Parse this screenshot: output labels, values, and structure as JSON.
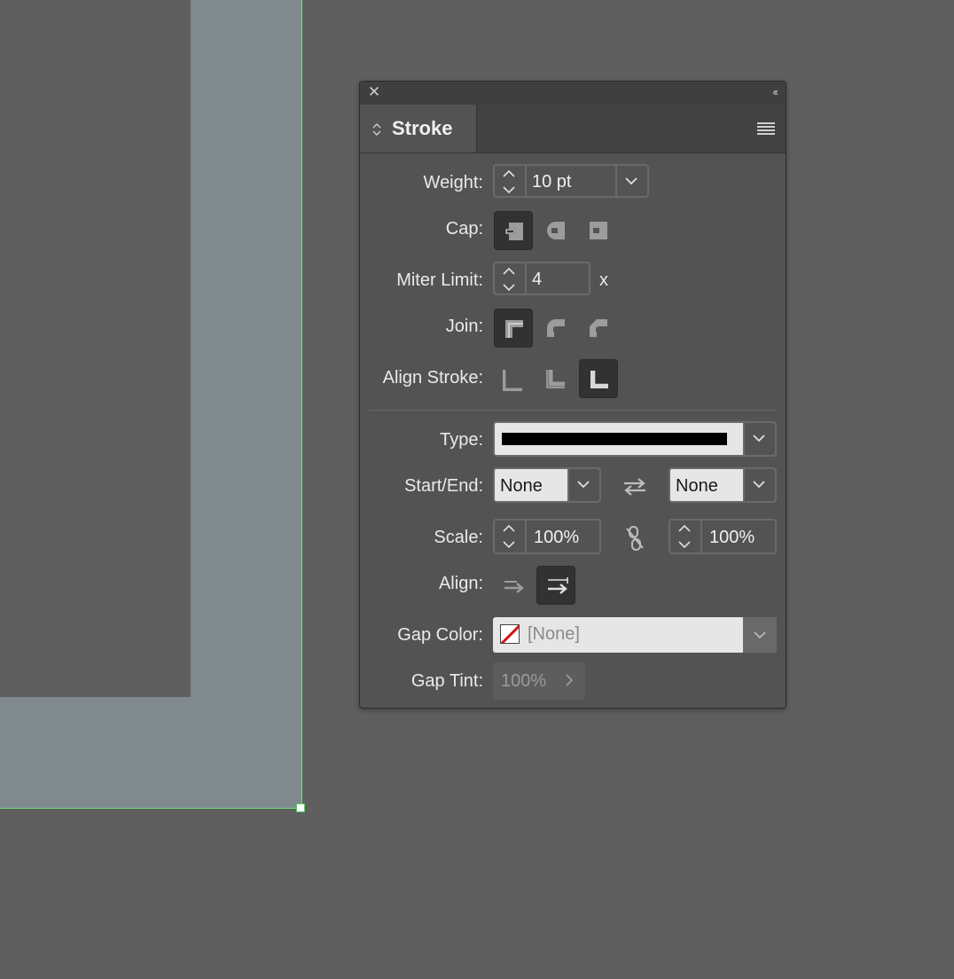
{
  "panel": {
    "close_icon": "close-icon",
    "collapse_icon": "double-chevron-left-icon",
    "tab_label": "Stroke",
    "menu_icon": "panel-menu-icon"
  },
  "labels": {
    "weight": "Weight:",
    "cap": "Cap:",
    "miter_limit": "Miter Limit:",
    "join": "Join:",
    "align_stroke": "Align Stroke:",
    "type": "Type:",
    "start_end": "Start/End:",
    "scale": "Scale:",
    "align": "Align:",
    "gap_color": "Gap Color:",
    "gap_tint": "Gap Tint:"
  },
  "values": {
    "weight": "10 pt",
    "miter_limit": "4",
    "miter_unit": "x",
    "start": "None",
    "end": "None",
    "scale_start": "100%",
    "scale_end": "100%",
    "gap_color": "[None]",
    "gap_tint": "100%"
  },
  "selection": {
    "cap": "butt",
    "join": "miter",
    "align_stroke": "outside",
    "align": "fit-to-path"
  },
  "colors": {
    "selection_outline": "#6fe07a",
    "stroke_type_swatch": "#000000",
    "gap_none_slash": "#d01616"
  }
}
